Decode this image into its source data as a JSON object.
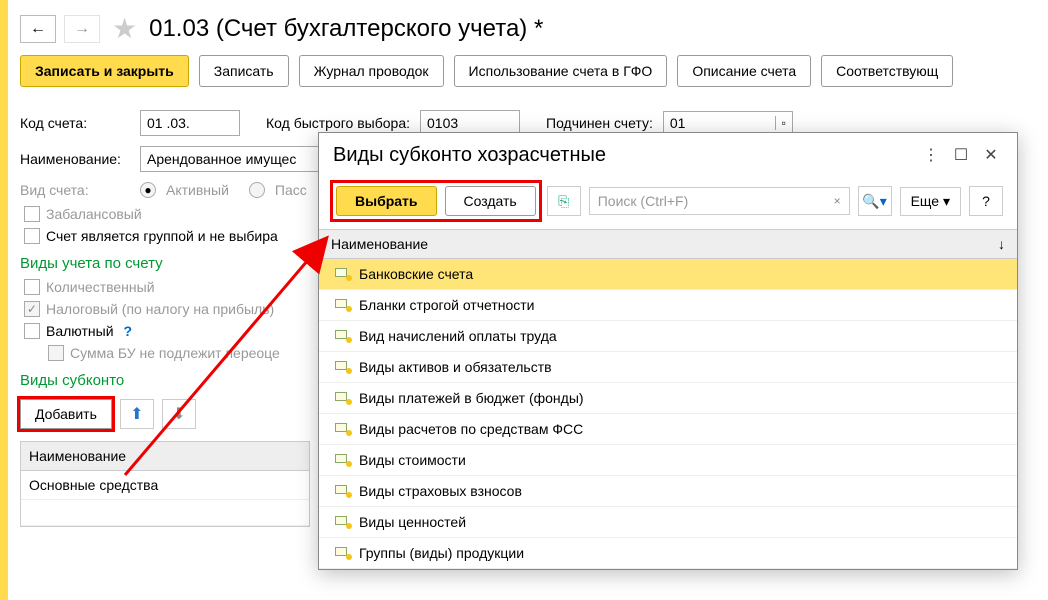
{
  "titlebar": {
    "title": "01.03 (Счет бухгалтерского учета) *"
  },
  "toolbar": {
    "save_close": "Записать и закрыть",
    "save": "Записать",
    "journal": "Журнал проводок",
    "gfo": "Использование счета в ГФО",
    "desc": "Описание счета",
    "corr": "Соответствующ"
  },
  "form": {
    "code_label": "Код счета:",
    "code_value": "01 .03.",
    "quick_label": "Код быстрого выбора:",
    "quick_value": "0103",
    "parent_label": "Подчинен счету:",
    "parent_value": "01",
    "name_label": "Наименование:",
    "name_value": "Арендованное имущес",
    "type_label": "Вид счета:",
    "type_active": "Активный",
    "type_passive": "Пасс",
    "offbalance": "Забалансовый",
    "is_group": "Счет является группой и не выбира"
  },
  "accounting_types": {
    "title": "Виды учета по счету",
    "qty": "Количественный",
    "tax": "Налоговый (по налогу на прибыль)",
    "currency": "Валютный",
    "bu_sum": "Сумма БУ не подлежит переоце"
  },
  "subconto": {
    "title": "Виды субконто",
    "add": "Добавить",
    "table_header": "Наименование",
    "row1": "Основные средства"
  },
  "dialog": {
    "title": "Виды субконто хозрасчетные",
    "select": "Выбрать",
    "create": "Создать",
    "search_placeholder": "Поиск (Ctrl+F)",
    "more": "Еще",
    "list_header": "Наименование",
    "items": [
      "Банковские счета",
      "Бланки строгой отчетности",
      "Вид начислений оплаты труда",
      "Виды активов и обязательств",
      "Виды платежей в бюджет (фонды)",
      "Виды расчетов по средствам ФСС",
      "Виды стоимости",
      "Виды страховых взносов",
      "Виды ценностей",
      "Группы (виды) продукции"
    ]
  }
}
